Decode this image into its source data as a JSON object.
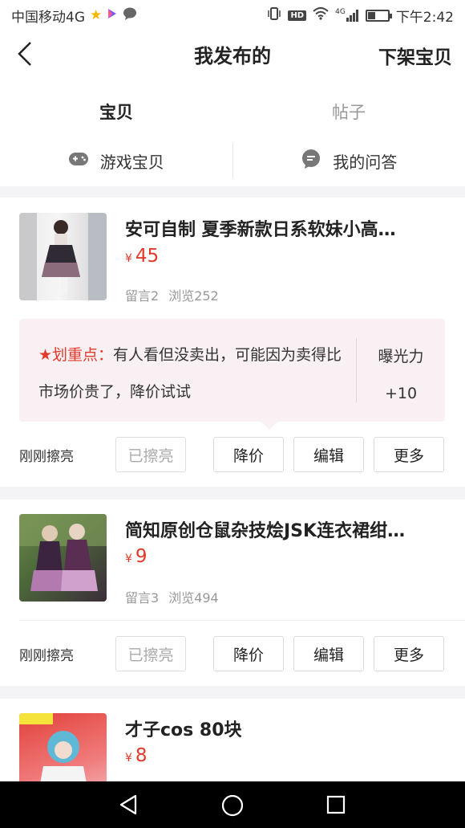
{
  "status_bar": {
    "carrier": "中国移动4G",
    "hd": "HD",
    "net": "4G",
    "time": "下午2:42"
  },
  "header": {
    "title": "我发布的",
    "right_action": "下架宝贝"
  },
  "tabs": [
    {
      "label": "宝贝",
      "active": true
    },
    {
      "label": "帖子",
      "active": false
    }
  ],
  "subtabs": [
    {
      "label": "游戏宝贝",
      "icon": "gamepad-icon"
    },
    {
      "label": "我的问答",
      "icon": "chat-bubble-icon"
    }
  ],
  "items": [
    {
      "title": "安可自制 夏季新款日系软妹小高…",
      "price_symbol": "¥",
      "price": "45",
      "comments": "留言2",
      "views": "浏览252",
      "tip": {
        "highlight": "★划重点：",
        "text": "有人看但没卖出，可能因为卖得比市场价贵了，降价试试",
        "exposure_label": "曝光力",
        "exposure_value": "+10"
      },
      "polish_status": "刚刚擦亮",
      "buttons": [
        "已擦亮",
        "降价",
        "编辑",
        "更多"
      ]
    },
    {
      "title": "简知原创仓鼠杂技烩JSK连衣裙绀…",
      "price_symbol": "¥",
      "price": "9",
      "comments": "留言3",
      "views": "浏览494",
      "polish_status": "刚刚擦亮",
      "buttons": [
        "已擦亮",
        "降价",
        "编辑",
        "更多"
      ]
    },
    {
      "title": "才子cos   80块",
      "price_symbol": "¥",
      "price": "8"
    }
  ],
  "colors": {
    "accent_yellow": "#ffd11a",
    "price_red": "#e23a2a",
    "tip_bg": "#f8f0f2"
  }
}
